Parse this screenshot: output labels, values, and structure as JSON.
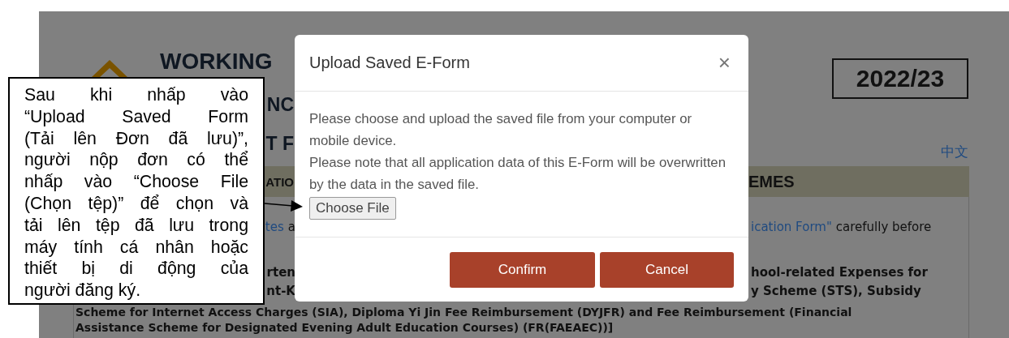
{
  "background": {
    "heading_lines": [
      "WORKING",
      "NC",
      "T F"
    ],
    "year": "2022/23",
    "language_link": "中文",
    "section_bar": [
      "ATIO",
      "EMES"
    ],
    "intro_left": [
      {
        "text": "tes",
        "link": true
      },
      {
        "text": "a",
        "link": false
      }
    ],
    "intro_right": [
      {
        "text": "ication Form\"",
        "link": true
      },
      {
        "text": "carefully before",
        "link": false
      }
    ],
    "scheme_lines": [
      {
        "left": "rten",
        "right": "hool-related Expenses for"
      },
      {
        "left": "nt-K",
        "right": "y Scheme (STS), Subsidy"
      }
    ],
    "scheme_full_lines": [
      "Scheme for Internet Access Charges (SIA), Diploma Yi Jin Fee Reimbursement (DYJFR) and Fee Reimbursement (Financial",
      "Assistance Scheme for Designated Evening Adult Education Courses) (FR(FAEAEC))]"
    ]
  },
  "dialog": {
    "title": "Upload Saved E-Form",
    "close": "×",
    "paragraphs": [
      "Please choose and upload the saved file from your computer or mobile device.",
      "Please note that all application data of this E-Form will be overwritten by the data in the saved file."
    ],
    "file_button": "Choose File",
    "buttons": [
      {
        "label": "Confirm"
      },
      {
        "label": "Cancel"
      }
    ]
  },
  "callout": {
    "lines": [
      "Sau khi nhấp vào",
      "“Upload Saved Form",
      "(Tải lên Đơn đã lưu)”,",
      "người nộp đơn có thể",
      "nhấp vào “Choose File",
      "(Chọn tệp)” để chọn và",
      "tải lên tệp đã lưu trong",
      "máy tính cá nhân hoặc",
      "thiết bị di động của",
      "người đăng ký."
    ]
  }
}
